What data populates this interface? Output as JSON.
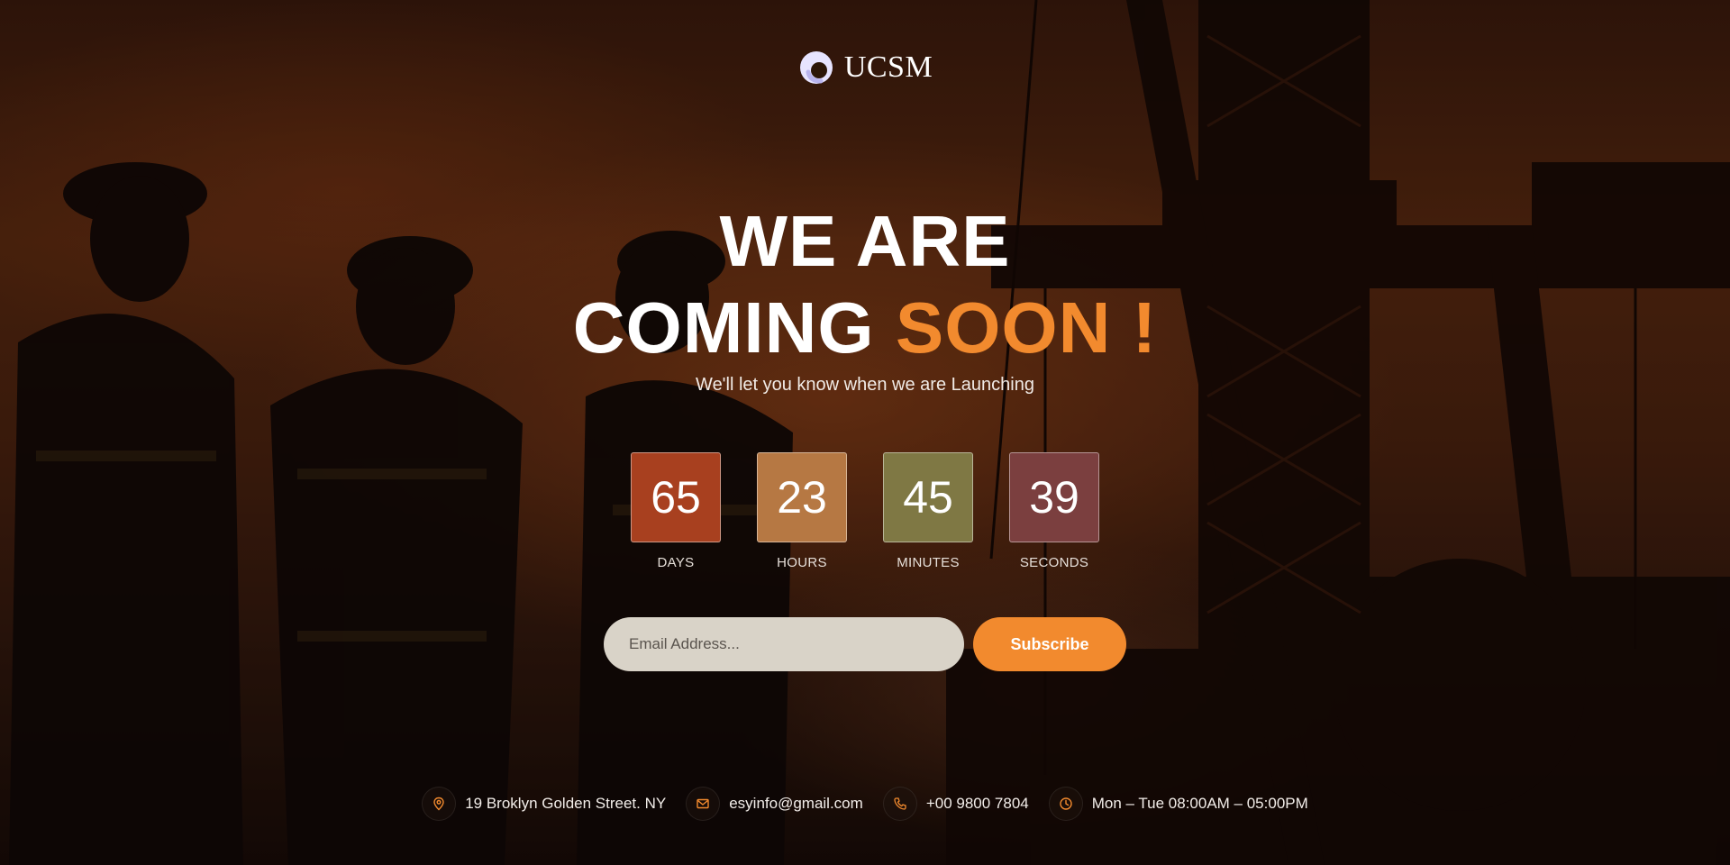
{
  "brand": {
    "name": "UCSM",
    "accent_color": "#f28a2e"
  },
  "hero": {
    "line1": "WE ARE",
    "line2_white": "COMING",
    "line2_accent": "SOON !",
    "tagline": "We'll let you know when we are Launching"
  },
  "countdown": [
    {
      "value": "65",
      "label": "DAYS",
      "color": "#a8401f"
    },
    {
      "value": "23",
      "label": "HOURS",
      "color": "#b67843"
    },
    {
      "value": "45",
      "label": "MINUTES",
      "color": "#7f7844"
    },
    {
      "value": "39",
      "label": "SECONDS",
      "color": "#7b3f3f"
    }
  ],
  "subscribe": {
    "placeholder": "Email Address...",
    "button_label": "Subscribe"
  },
  "contact": {
    "address": {
      "icon": "location-pin-icon",
      "text": "19 Broklyn Golden Street. NY"
    },
    "email": {
      "icon": "mail-icon",
      "text": "esyinfo@gmail.com"
    },
    "phone": {
      "icon": "phone-icon",
      "text": "+00 9800 7804"
    },
    "hours": {
      "icon": "clock-icon",
      "text": "Mon – Tue 08:00AM – 05:00PM"
    }
  }
}
